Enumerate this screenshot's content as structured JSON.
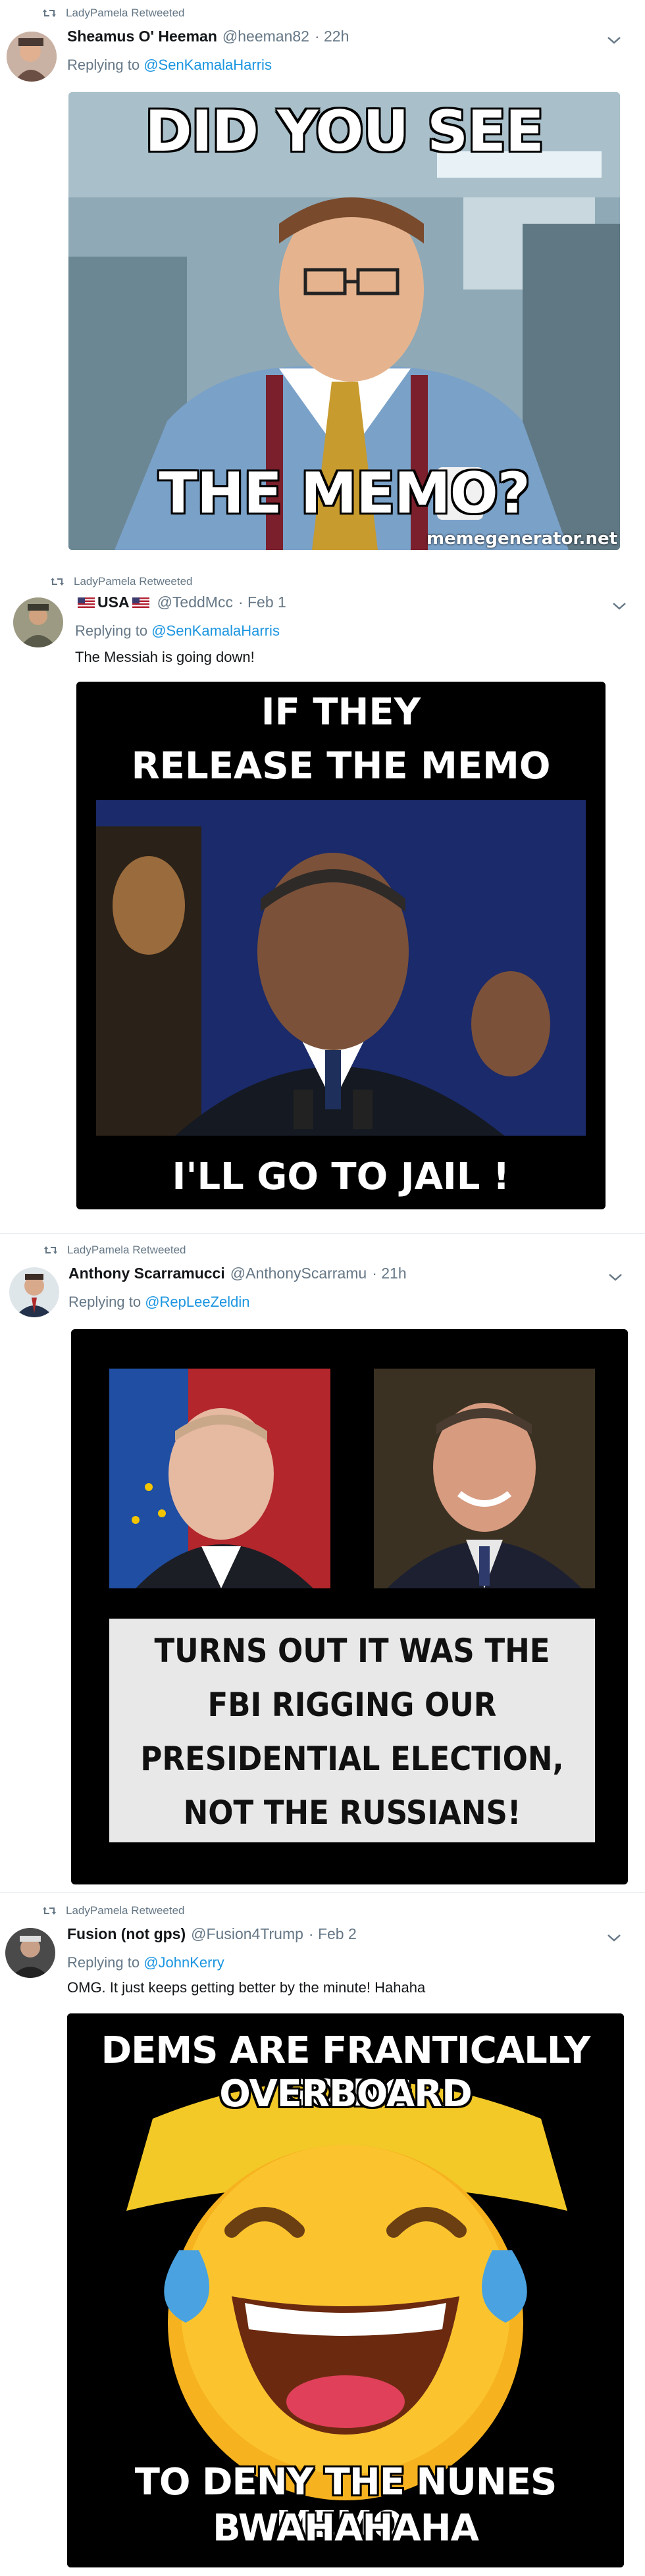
{
  "tweets": [
    {
      "retweeted_by": "LadyPamela Retweeted",
      "name": "Sheamus O' Heeman",
      "handle": "@heeman82",
      "time": "· 22h",
      "reply_prefix": "Replying to",
      "reply_to": "@SenKamalaHarris",
      "text": "",
      "media": {
        "top_caption": "DID YOU SEE",
        "bottom_caption": "THE MEMO?",
        "watermark": "memegenerator.net"
      }
    },
    {
      "retweeted_by": "LadyPamela Retweeted",
      "name": "USA",
      "handle": "@TeddMcc",
      "time": "· Feb 1",
      "reply_prefix": "Replying to",
      "reply_to": "@SenKamalaHarris",
      "text": "The Messiah is going down!",
      "media": {
        "top_line1": "IF THEY",
        "top_line2": "RELEASE THE MEMO",
        "bottom_caption": "I'LL GO TO JAIL !"
      }
    },
    {
      "retweeted_by": "LadyPamela Retweeted",
      "name": "Anthony Scarramucci",
      "handle": "@AnthonyScarramu",
      "time": "· 21h",
      "reply_prefix": "Replying to",
      "reply_to": "@RepLeeZeldin",
      "text": "",
      "media": {
        "lines": [
          "TURNS OUT IT WAS THE",
          "FBI RIGGING OUR",
          "PRESIDENTIAL ELECTION,",
          "NOT THE RUSSIANS!"
        ]
      }
    },
    {
      "retweeted_by": "LadyPamela Retweeted",
      "name": "Fusion (not gps)",
      "handle": "@Fusion4Trump",
      "time": "· Feb 2",
      "reply_prefix": "Replying to",
      "reply_to": "@JohnKerry",
      "text": "OMG. It just keeps getting better by the minute! Hahaha",
      "media": {
        "top_line1": "DEMS ARE FRANTICALLY GOING",
        "top_line2": "OVERBOARD",
        "bottom_line1": "TO DENY THE NUNES MEMO.",
        "bottom_line2": "BWAHAHAHA"
      }
    }
  ],
  "colors": {
    "link": "#1b95e0",
    "muted": "#657786",
    "text": "#14171a",
    "divider": "#e6ecf0"
  }
}
